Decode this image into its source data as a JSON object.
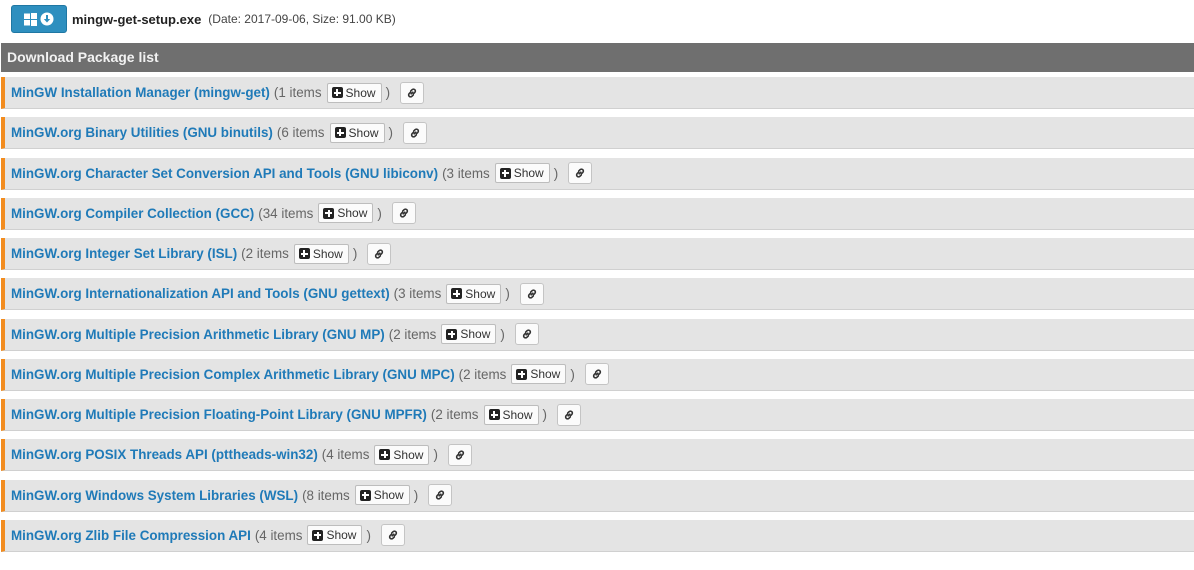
{
  "download": {
    "button_icons": [
      "windows-icon",
      "download-circle-icon"
    ],
    "file_name": "mingw-get-setup.exe",
    "file_meta": "(Date: 2017-09-06, Size: 91.00 KB)"
  },
  "list": {
    "header": "Download Package list",
    "show_label": "Show",
    "packages": [
      {
        "name": "MinGW Installation Manager (mingw-get)",
        "count": "1 items"
      },
      {
        "name": "MinGW.org Binary Utilities (GNU binutils)",
        "count": "6 items"
      },
      {
        "name": "MinGW.org Character Set Conversion API and Tools (GNU libiconv)",
        "count": "3 items"
      },
      {
        "name": "MinGW.org Compiler Collection (GCC)",
        "count": "34 items"
      },
      {
        "name": "MinGW.org Integer Set Library (ISL)",
        "count": "2 items"
      },
      {
        "name": "MinGW.org Internationalization API and Tools (GNU gettext)",
        "count": "3 items"
      },
      {
        "name": "MinGW.org Multiple Precision Arithmetic Library (GNU MP)",
        "count": "2 items"
      },
      {
        "name": "MinGW.org Multiple Precision Complex Arithmetic Library (GNU MPC)",
        "count": "2 items"
      },
      {
        "name": "MinGW.org Multiple Precision Floating-Point Library (GNU MPFR)",
        "count": "2 items"
      },
      {
        "name": "MinGW.org POSIX Threads API (pttheads-win32)",
        "count": "4 items"
      },
      {
        "name": "MinGW.org Windows System Libraries (WSL)",
        "count": "8 items"
      },
      {
        "name": "MinGW.org Zlib File Compression API",
        "count": "4 items"
      }
    ]
  },
  "colors": {
    "accent_orange": "#f28c1f",
    "link_blue": "#1f7ab8",
    "header_gray": "#6f6f6f",
    "row_gray": "#e4e4e4",
    "button_blue": "#2e8fbf"
  }
}
